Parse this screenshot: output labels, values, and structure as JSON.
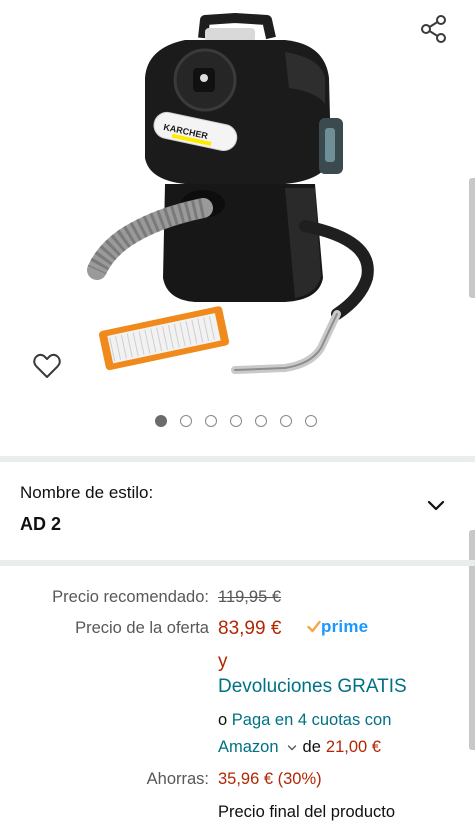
{
  "gallery": {
    "product_image": "karcher-ash-vacuum",
    "brand_label": "KARCHER",
    "share_icon": "share-icon",
    "wishlist_icon": "heart-icon",
    "image_count": 7,
    "active_index": 0
  },
  "style": {
    "label": "Nombre de estilo:",
    "value": "AD 2",
    "dropdown_icon": "chevron-down-icon"
  },
  "pricing": {
    "list_price_label": "Precio recomendado:",
    "list_price": "119,95 €",
    "deal_label": "Precio de la oferta",
    "deal_price": "83,99 €",
    "prime_label": "prime",
    "conjunction": "y",
    "returns": "Devoluciones GRATIS",
    "installments_prefix": "o",
    "installments_link": "Paga en 4 cuotas con",
    "installments_link_2": "Amazon",
    "installments_of": "de",
    "installments_amount": "21,00 €",
    "savings_label": "Ahorras:",
    "savings_value": "35,96 € (30%)",
    "final_price_note": "Precio final del producto"
  },
  "colors": {
    "price_red": "#b12704",
    "link_teal": "#007185",
    "prime_blue": "#1a98ff",
    "divider": "#e9eded"
  }
}
